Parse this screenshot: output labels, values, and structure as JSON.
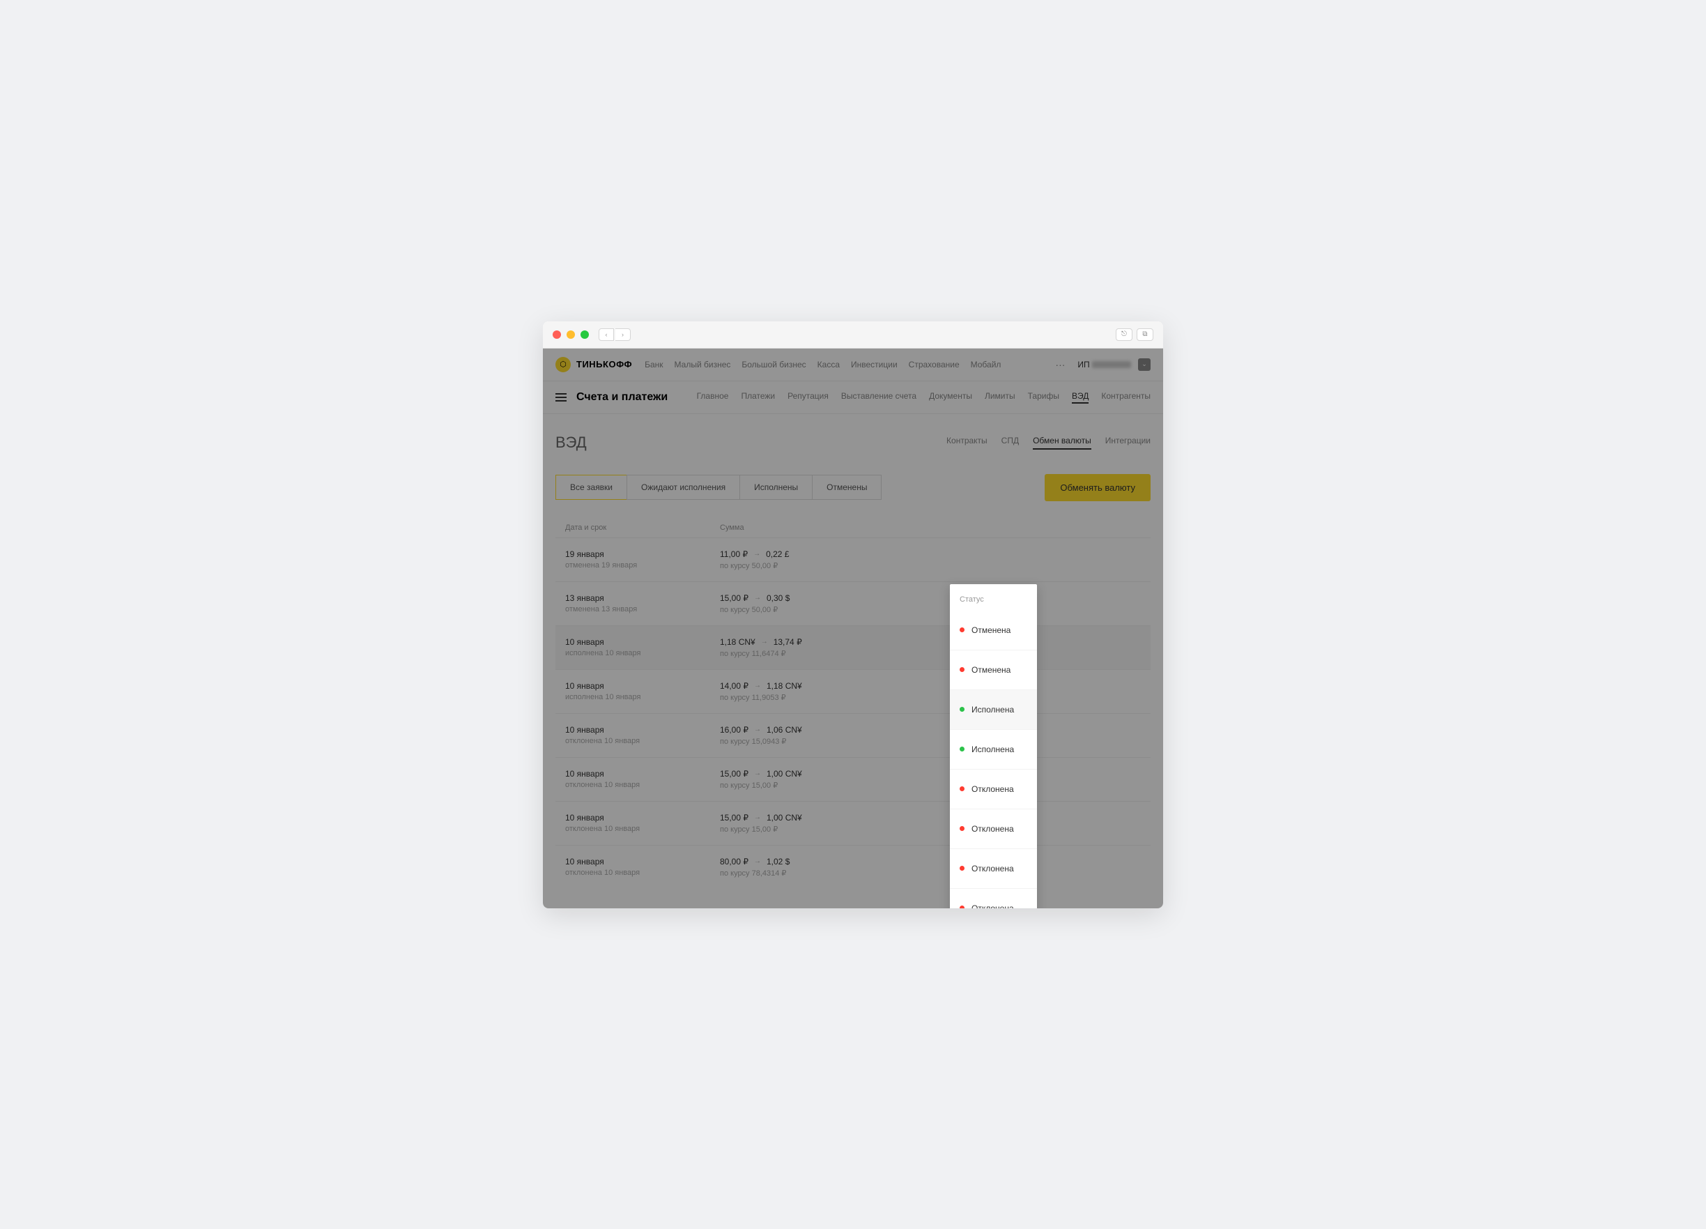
{
  "brand": "ТИНЬКОФФ",
  "topNav": [
    "Банк",
    "Малый бизнес",
    "Большой бизнес",
    "Касса",
    "Инвестиции",
    "Страхование",
    "Мобайл"
  ],
  "userLabel": "ИП",
  "sectionTitle": "Счета и платежи",
  "subNav": [
    {
      "label": "Главное",
      "active": false
    },
    {
      "label": "Платежи",
      "active": false
    },
    {
      "label": "Репутация",
      "active": false
    },
    {
      "label": "Выставление счета",
      "active": false
    },
    {
      "label": "Документы",
      "active": false
    },
    {
      "label": "Лимиты",
      "active": false
    },
    {
      "label": "Тарифы",
      "active": false
    },
    {
      "label": "ВЭД",
      "active": true
    },
    {
      "label": "Контрагенты",
      "active": false
    }
  ],
  "pageTitle": "ВЭД",
  "pageTabs": [
    {
      "label": "Контракты",
      "active": false
    },
    {
      "label": "СПД",
      "active": false
    },
    {
      "label": "Обмен валюты",
      "active": true
    },
    {
      "label": "Интеграции",
      "active": false
    }
  ],
  "filters": [
    {
      "label": "Все заявки",
      "active": true
    },
    {
      "label": "Ожидают исполнения",
      "active": false
    },
    {
      "label": "Исполнены",
      "active": false
    },
    {
      "label": "Отменены",
      "active": false
    }
  ],
  "exchangeBtn": "Обменять валюту",
  "columns": {
    "date": "Дата и срок",
    "sum": "Сумма",
    "status": "Статус"
  },
  "rows": [
    {
      "date": "19 января",
      "sub": "отменена 19 января",
      "from": "11,00 ₽",
      "to": "0,22 £",
      "rate": "по курсу 50,00 ₽",
      "status": "Отменена",
      "dot": "red",
      "hover": false
    },
    {
      "date": "13 января",
      "sub": "отменена 13 января",
      "from": "15,00 ₽",
      "to": "0,30 $",
      "rate": "по курсу 50,00 ₽",
      "status": "Отменена",
      "dot": "red",
      "hover": false
    },
    {
      "date": "10 января",
      "sub": "исполнена 10 января",
      "from": "1,18 CN¥",
      "to": "13,74 ₽",
      "rate": "по курсу 11,6474 ₽",
      "status": "Исполнена",
      "dot": "green",
      "hover": true
    },
    {
      "date": "10 января",
      "sub": "исполнена 10 января",
      "from": "14,00 ₽",
      "to": "1,18 CN¥",
      "rate": "по курсу 11,9053 ₽",
      "status": "Исполнена",
      "dot": "green",
      "hover": false
    },
    {
      "date": "10 января",
      "sub": "отклонена 10 января",
      "from": "16,00 ₽",
      "to": "1,06 CN¥",
      "rate": "по курсу 15,0943 ₽",
      "status": "Отклонена",
      "dot": "red",
      "hover": false
    },
    {
      "date": "10 января",
      "sub": "отклонена 10 января",
      "from": "15,00 ₽",
      "to": "1,00 CN¥",
      "rate": "по курсу 15,00 ₽",
      "status": "Отклонена",
      "dot": "red",
      "hover": false
    },
    {
      "date": "10 января",
      "sub": "отклонена 10 января",
      "from": "15,00 ₽",
      "to": "1,00 CN¥",
      "rate": "по курсу 15,00 ₽",
      "status": "Отклонена",
      "dot": "red",
      "hover": false
    },
    {
      "date": "10 января",
      "sub": "отклонена 10 января",
      "from": "80,00 ₽",
      "to": "1,02 $",
      "rate": "по курсу 78,4314 ₽",
      "status": "Отклонена",
      "dot": "red",
      "hover": false
    }
  ]
}
